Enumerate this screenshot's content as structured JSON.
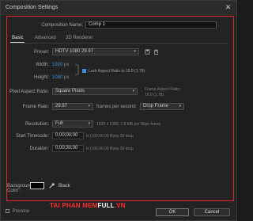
{
  "window": {
    "title": "Composition Settings"
  },
  "comp_name": {
    "label": "Composition Name:",
    "value": "Comp 1"
  },
  "tabs": [
    {
      "label": "Basic"
    },
    {
      "label": "Advanced"
    },
    {
      "label": "3D Renderer"
    }
  ],
  "preset": {
    "label": "Preset:",
    "value": "HDTV 1080 29.97"
  },
  "width": {
    "label": "Width:",
    "value": "1920",
    "unit": "px"
  },
  "height": {
    "label": "Height:",
    "value": "1080",
    "unit": "px"
  },
  "lock_aspect": {
    "label": "Lock Aspect Ratio to 16:9 (1.78)",
    "checked": true
  },
  "pixel_aspect": {
    "label": "Pixel Aspect Ratio:",
    "value": "Square Pixels",
    "frame_aspect_label": "Frame Aspect Ratio:",
    "frame_aspect_value": "16:9 (1.78)"
  },
  "frame_rate": {
    "label": "Frame Rate:",
    "value": "29.97",
    "unit": "frames per second",
    "mode": "Drop Frame"
  },
  "resolution": {
    "label": "Resolution:",
    "value": "Full",
    "info": "1920 x 1080, 7.9 MB per 8bpc frame"
  },
  "start_timecode": {
    "label": "Start Timecode:",
    "value": "0;00;00;00",
    "note": "is 0;00;00;00  Base 30  drop"
  },
  "duration": {
    "label": "Duration:",
    "value": "0;00;30;00",
    "note": "is 0;00;30;00  Base 30  drop"
  },
  "background": {
    "label": "Background Color:",
    "color_name": "Black",
    "swatch_color": "#000000"
  },
  "footer": {
    "preview_label": "Preview",
    "ok_label": "OK",
    "cancel_label": "Cancel"
  },
  "brand": {
    "part1": "TAI PHAN MEM",
    "part2": "FULL",
    "part3": ".VN"
  },
  "colors": {
    "accent_blue": "#3b8de0",
    "highlight_red": "#e1262d"
  },
  "icons": [
    "close-icon",
    "save-preset-icon",
    "delete-preset-icon",
    "eyedropper-icon",
    "link-icon",
    "chevron-down-icon"
  ]
}
